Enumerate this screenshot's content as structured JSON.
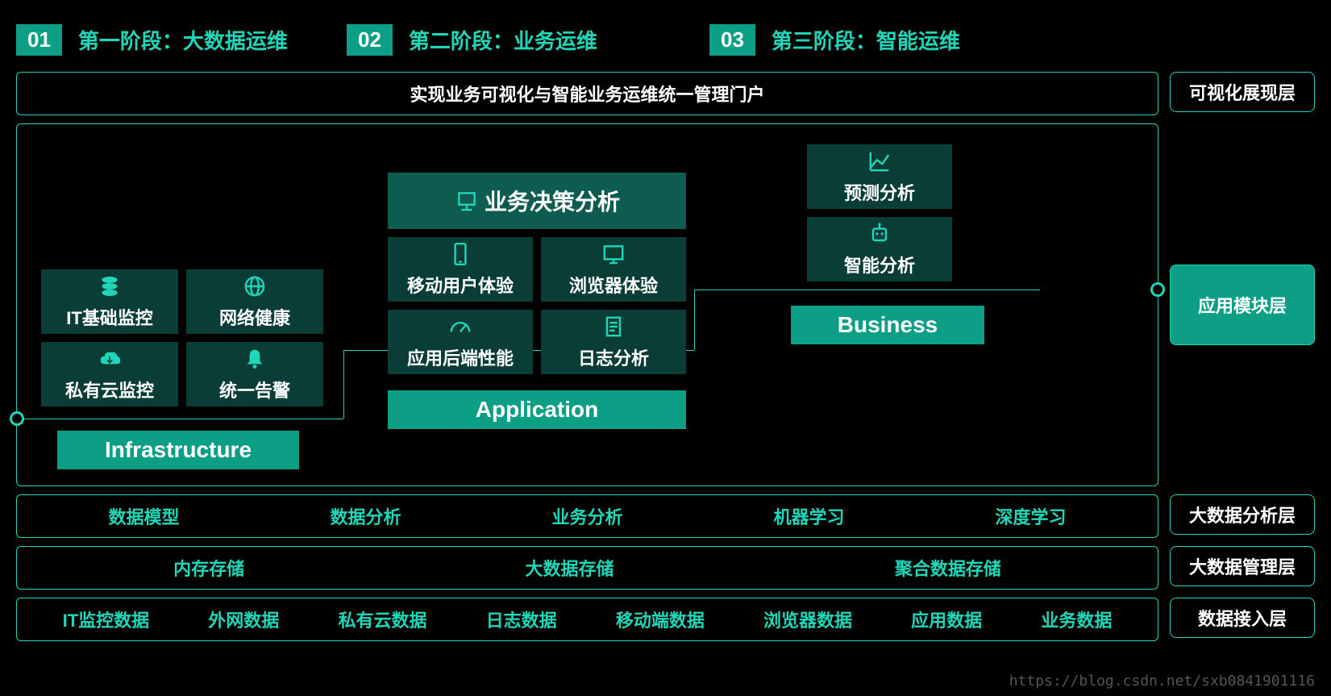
{
  "phases": [
    {
      "num": "01",
      "label": "第一阶段：大数据运维"
    },
    {
      "num": "02",
      "label": "第二阶段：业务运维"
    },
    {
      "num": "03",
      "label": "第三阶段：智能运维"
    }
  ],
  "top_band": "实现业务可视化与智能业务运维统一管理门户",
  "right_labels": {
    "vis": "可视化展现层",
    "app": "应用模块层",
    "analysis": "大数据分析层",
    "mgmt": "大数据管理层",
    "access": "数据接入层"
  },
  "infra": {
    "title": "Infrastructure",
    "cards": {
      "it": "IT基础监控",
      "net": "网络健康",
      "cloud": "私有云监控",
      "alert": "统一告警"
    }
  },
  "app": {
    "title": "Application",
    "cards": {
      "decision": "业务决策分析",
      "mobile": "移动用户体验",
      "browser": "浏览器体验",
      "backend": "应用后端性能",
      "log": "日志分析"
    }
  },
  "biz": {
    "title": "Business",
    "cards": {
      "predict": "预测分析",
      "smart": "智能分析"
    }
  },
  "analysis_band": [
    "数据模型",
    "数据分析",
    "业务分析",
    "机器学习",
    "深度学习"
  ],
  "mgmt_band": [
    "内存存储",
    "大数据存储",
    "聚合数据存储"
  ],
  "access_band": [
    "IT监控数据",
    "外网数据",
    "私有云数据",
    "日志数据",
    "移动端数据",
    "浏览器数据",
    "应用数据",
    "业务数据"
  ],
  "watermark": "https://blog.csdn.net/sxb0841901116"
}
